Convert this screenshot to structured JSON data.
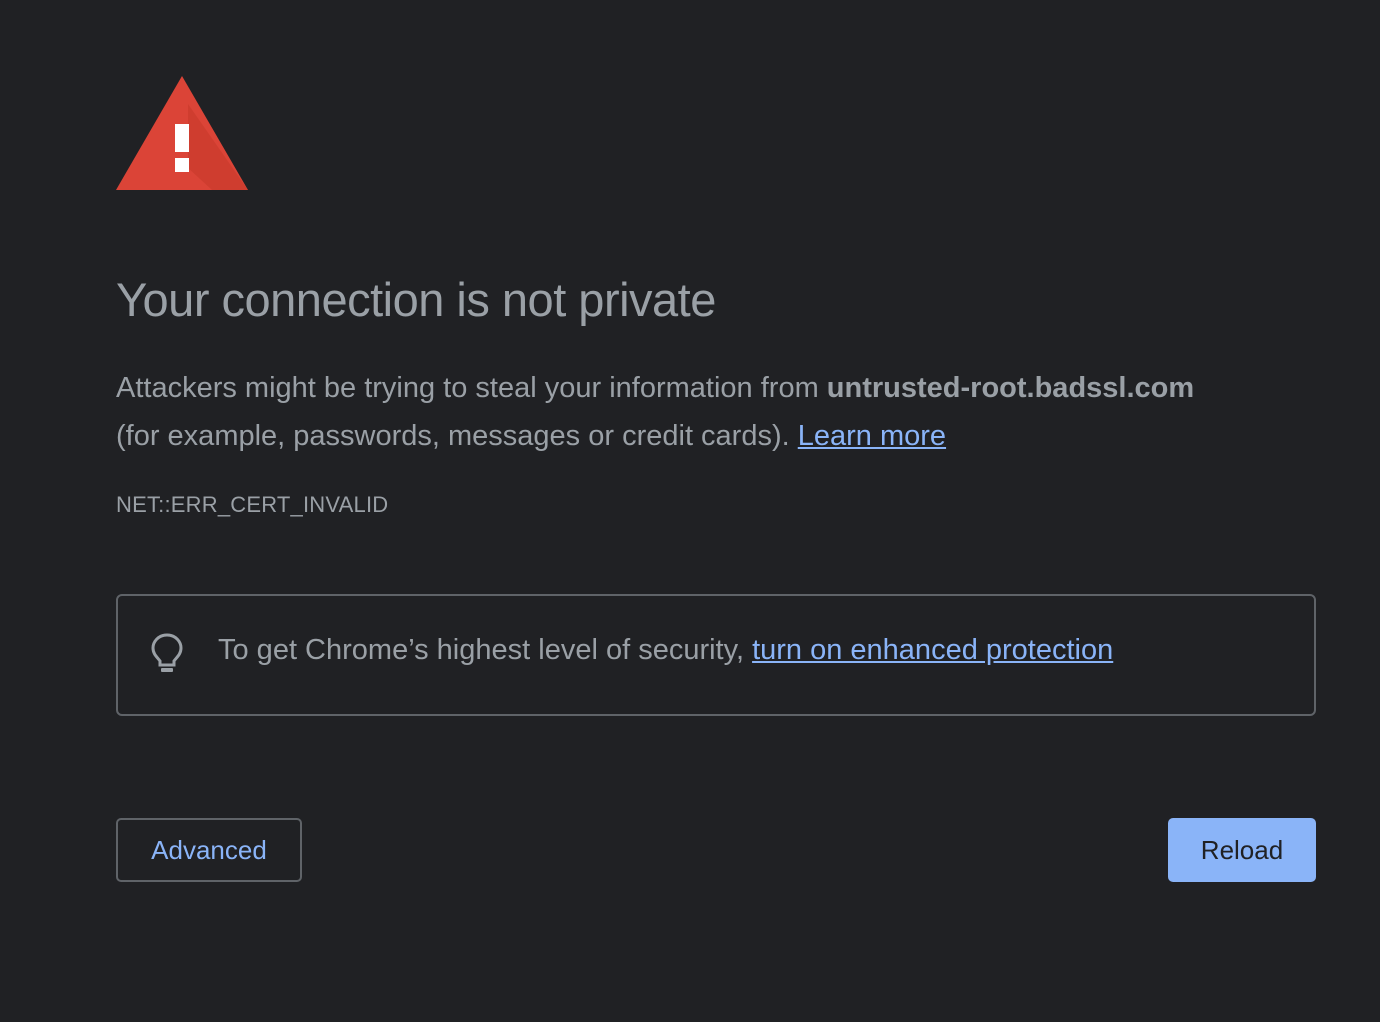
{
  "interstitial": {
    "heading": "Your connection is not private",
    "explanation_prefix": "Attackers might be trying to steal your information from ",
    "domain": "untrusted-root.badssl.com",
    "explanation_suffix": "(for example, passwords, messages or credit cards).",
    "learn_more_label": "Learn more",
    "error_code": "NET::ERR_CERT_INVALID",
    "icon": "warning-triangle-icon"
  },
  "enhanced_protection": {
    "icon": "lightbulb-icon",
    "text": "To get Chrome’s highest level of security,",
    "link_label": "turn on enhanced protection"
  },
  "buttons": {
    "advanced_label": "Advanced",
    "reload_label": "Reload"
  },
  "colors": {
    "background": "#202124",
    "text": "#9aa0a6",
    "link": "#8ab4f8",
    "warning_red": "#db4437",
    "border": "#5f6368"
  }
}
